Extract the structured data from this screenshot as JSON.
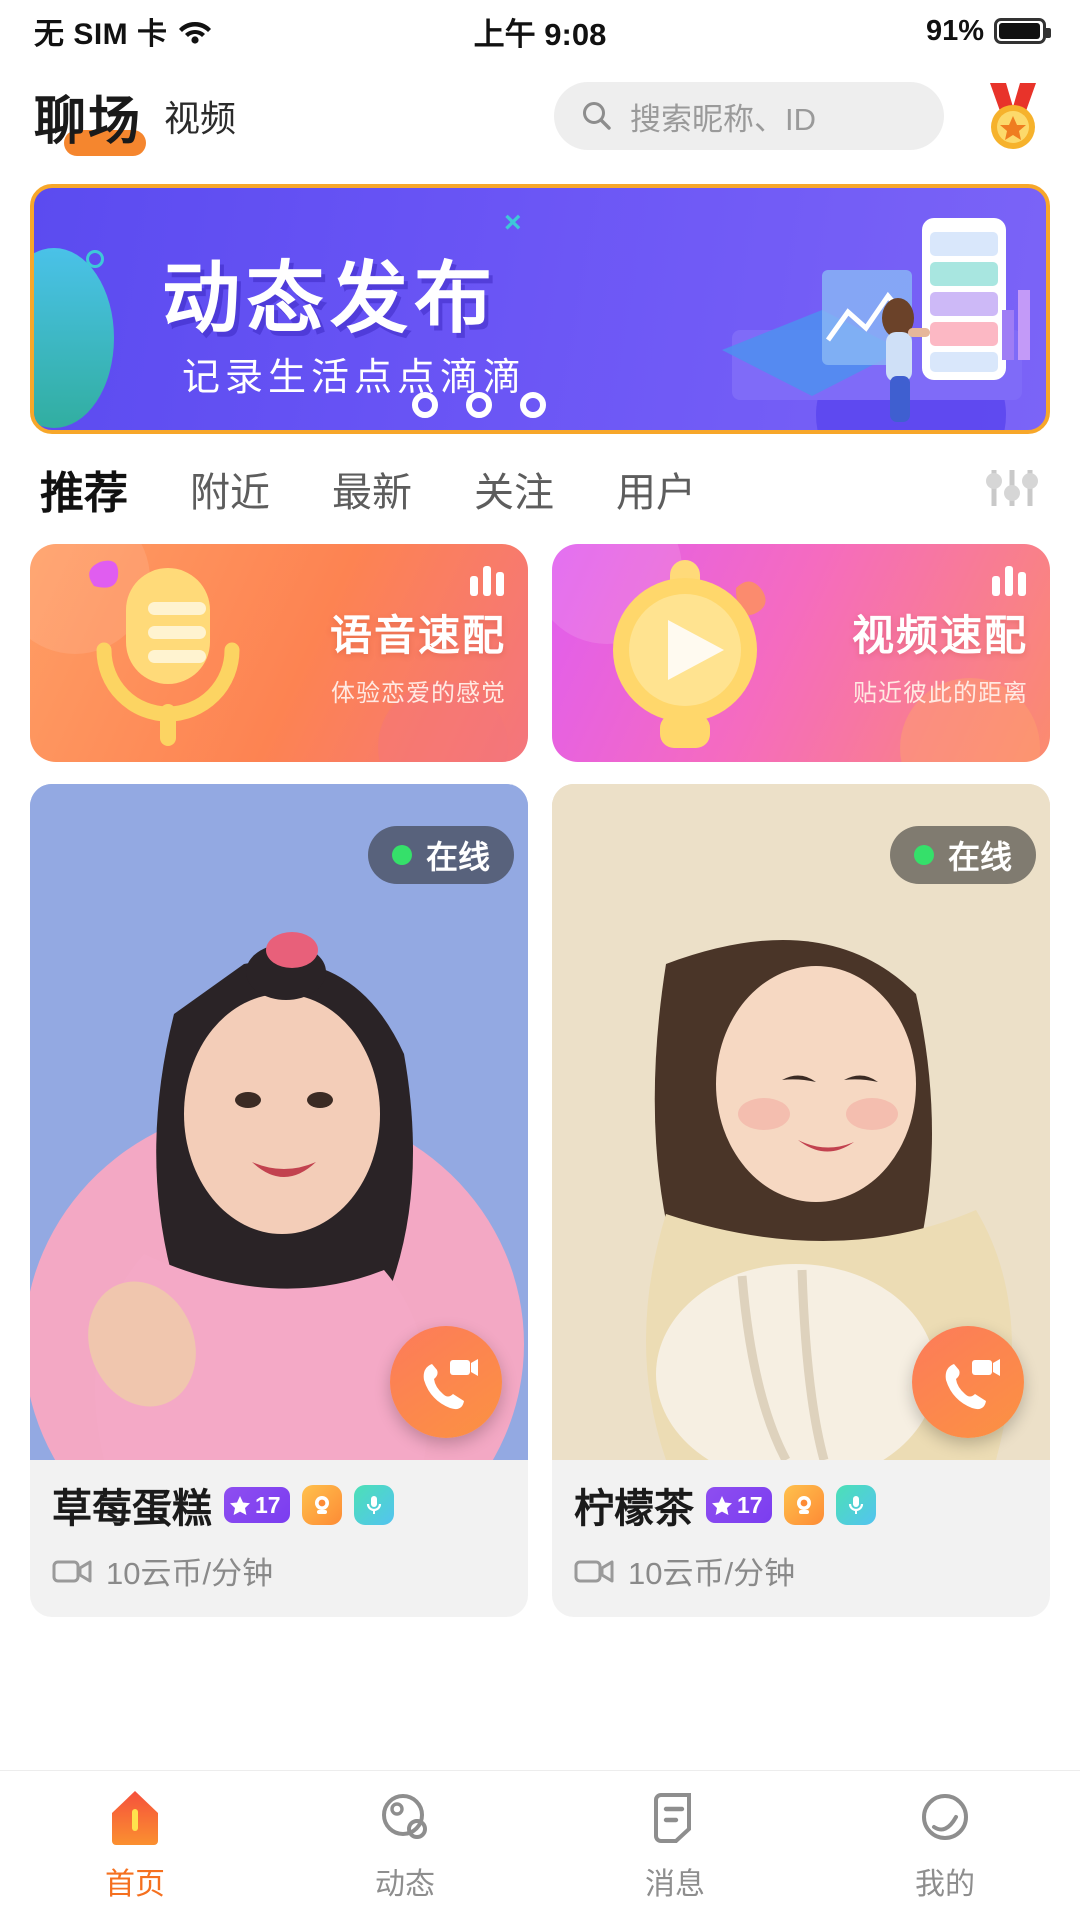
{
  "status_bar": {
    "carrier": "无 SIM 卡",
    "time": "上午 9:08",
    "battery_percent": "91%",
    "wifi_icon": "wifi-icon",
    "battery_icon": "battery-icon"
  },
  "header": {
    "logo": "聊场",
    "subnav": "视频",
    "search_placeholder": "搜索昵称、ID",
    "search_icon": "search-icon",
    "medal_icon": "medal-icon"
  },
  "banner": {
    "title": "动态发布",
    "subtitle": "记录生活点点滴滴",
    "deco_x": "×",
    "dots": [
      "dot-1",
      "dot-2",
      "dot-3"
    ],
    "border_color": "#f7a72a",
    "bg_color": "#6a55f5"
  },
  "tabs": {
    "items": [
      {
        "label": "推荐",
        "active": true
      },
      {
        "label": "附近",
        "active": false
      },
      {
        "label": "最新",
        "active": false
      },
      {
        "label": "关注",
        "active": false
      },
      {
        "label": "用户",
        "active": false
      }
    ],
    "filter_icon": "sliders-filter-icon"
  },
  "features": [
    {
      "title": "语音速配",
      "subtitle": "体验恋爱的感觉",
      "icon": "microphone-icon",
      "wave_icon": "sound-wave-icon",
      "accent": "#fd8352"
    },
    {
      "title": "视频速配",
      "subtitle": "贴近彼此的距离",
      "icon": "video-play-icon",
      "wave_icon": "sound-wave-icon",
      "accent": "#f56bc0"
    }
  ],
  "users": [
    {
      "name": "草莓蛋糕",
      "status": "在线",
      "level": "17",
      "price": "10云币/分钟",
      "star_icon": "star-icon",
      "camera_badge_icon": "camera-badge-icon",
      "mic_badge_icon": "mic-badge-icon",
      "price_icon": "video-camera-icon",
      "call_icon": "video-call-icon",
      "photo_bg": "#8fa8e0"
    },
    {
      "name": "柠檬茶",
      "status": "在线",
      "level": "17",
      "price": "10云币/分钟",
      "star_icon": "star-icon",
      "camera_badge_icon": "camera-badge-icon",
      "mic_badge_icon": "mic-badge-icon",
      "price_icon": "video-camera-icon",
      "call_icon": "video-call-icon",
      "photo_bg": "#e8d9bf"
    }
  ],
  "bottom_nav": [
    {
      "label": "首页",
      "icon": "home-icon",
      "active": true
    },
    {
      "label": "动态",
      "icon": "moments-icon",
      "active": false
    },
    {
      "label": "消息",
      "icon": "message-icon",
      "active": false
    },
    {
      "label": "我的",
      "icon": "profile-icon",
      "active": false
    }
  ]
}
